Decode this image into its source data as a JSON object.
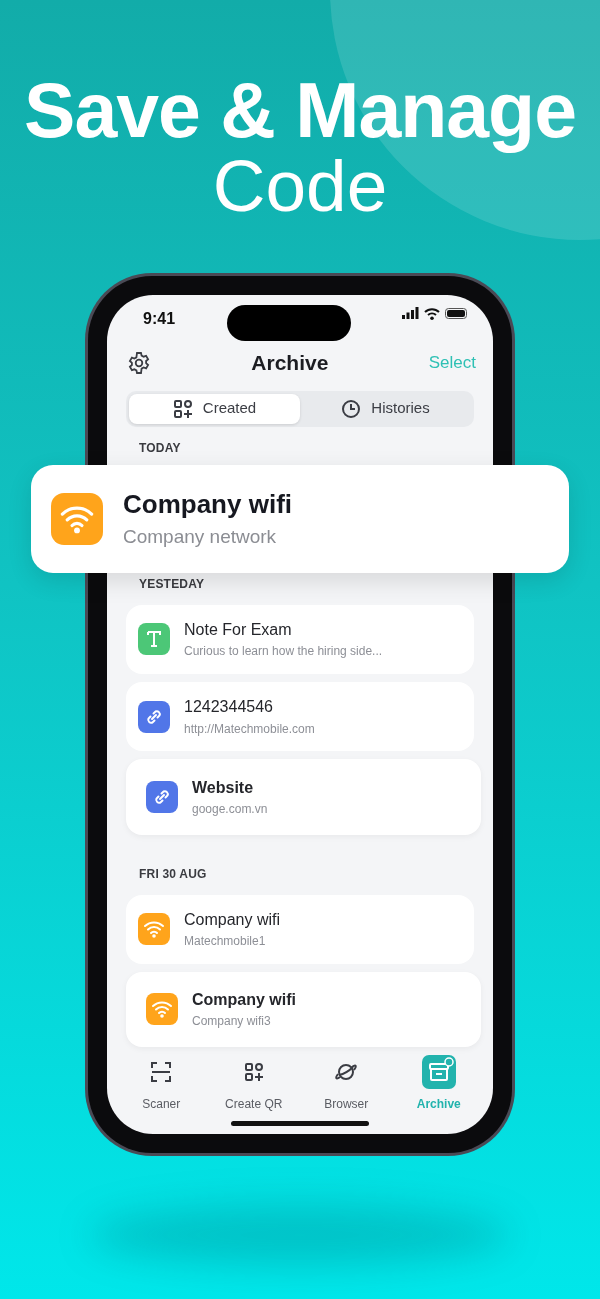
{
  "headline": {
    "line_1": "Save & Manage",
    "line_2": "Code"
  },
  "status_bar": {
    "time": "9:41"
  },
  "header": {
    "title": "Archive",
    "action": "Select"
  },
  "tabs": [
    {
      "label": "Created",
      "kind": "qr",
      "selected": true
    },
    {
      "label": "Histories",
      "kind": "clock",
      "selected": false
    }
  ],
  "sections": [
    {
      "heading": "TODAY"
    },
    {
      "heading": "YESTEDAY",
      "items": [
        {
          "kind": "text",
          "title": "Note For Exam",
          "subtitle": "Curious to learn how the hiring side...",
          "raised": false
        },
        {
          "kind": "link",
          "title": "1242344546",
          "subtitle": "http://Matechmobile.com",
          "raised": false
        },
        {
          "kind": "link",
          "title": "Website",
          "subtitle": "googe.com.vn",
          "raised": true
        }
      ]
    },
    {
      "heading": "FRI 30 AUG",
      "items": [
        {
          "kind": "wifi",
          "title": "Company wifi",
          "subtitle": "Matechmobile1",
          "raised": false
        },
        {
          "kind": "wifi",
          "title": "Company wifi",
          "subtitle": "Company wifi3",
          "raised": true
        }
      ]
    }
  ],
  "featured_item": {
    "kind": "wifi",
    "title": "Company wifi",
    "subtitle": "Company network"
  },
  "bottom_nav": [
    {
      "label": "Scaner",
      "kind": "scan",
      "selected": false
    },
    {
      "label": "Create QR",
      "kind": "qr",
      "selected": false
    },
    {
      "label": "Browser",
      "kind": "planet",
      "selected": false
    },
    {
      "label": "Archive",
      "kind": "archive",
      "selected": true
    }
  ]
}
